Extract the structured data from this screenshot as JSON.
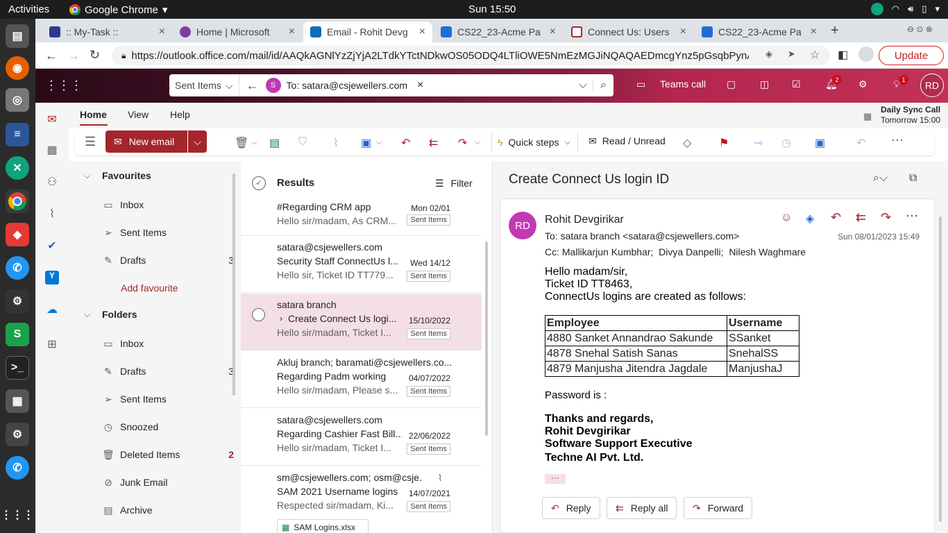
{
  "os": {
    "activities": "Activities",
    "app_name": "Google Chrome",
    "clock": "Sun 15:50"
  },
  "browser": {
    "tabs": [
      {
        "title": ":: My-Task ::",
        "color": "#2b3a8f"
      },
      {
        "title": "Home | Microsoft",
        "color": "#7b3fa0"
      },
      {
        "title": "Email - Rohit Devg",
        "color": "#0f6cbd"
      },
      {
        "title": "CS22_23-Acme Pac",
        "color": "#1e6fd9"
      },
      {
        "title": "Connect Us: Users",
        "color": "#a4262c"
      },
      {
        "title": "CS22_23-Acme Pac",
        "color": "#1e6fd9"
      }
    ],
    "url": "https://outlook.office.com/mail/id/AAQkAGNlYzZjYjA2LTdkYTctNDkwOS05ODQ4LTliOWE5NmEzMGJiNQAQAEDmcgYnz5pGsqbPynA4RGk...",
    "update_label": "Update"
  },
  "outlook": {
    "search_scope": "Sent Items",
    "search_chip_initial": "S",
    "search_chip_text": "To: satara@csjewellers.com",
    "teams_call": "Teams call",
    "notif_count": "2",
    "tips_count": "1",
    "user_initials": "RD",
    "reminder_title": "Daily Sync Call",
    "reminder_time": "Tomorrow 15:00"
  },
  "ribbon": {
    "tabs": [
      "Home",
      "View",
      "Help"
    ],
    "new_email": "New email",
    "quick_steps": "Quick steps",
    "read_unread": "Read / Unread"
  },
  "folders": {
    "favourites_header": "Favourites",
    "favourites": [
      {
        "name": "Inbox",
        "count": ""
      },
      {
        "name": "Sent Items",
        "count": ""
      },
      {
        "name": "Drafts",
        "count": "3"
      }
    ],
    "add_favourite": "Add favourite",
    "folders_header": "Folders",
    "items": [
      {
        "name": "Inbox",
        "count": ""
      },
      {
        "name": "Drafts",
        "count": "3"
      },
      {
        "name": "Sent Items",
        "count": ""
      },
      {
        "name": "Snoozed",
        "count": ""
      },
      {
        "name": "Deleted Items",
        "count": "2"
      },
      {
        "name": "Junk Email",
        "count": ""
      },
      {
        "name": "Archive",
        "count": ""
      }
    ]
  },
  "list": {
    "header": "Results",
    "filter": "Filter",
    "messages": [
      {
        "from": "",
        "subject": "#Regarding CRM app",
        "preview": "Hello sir/madam, As CRM...",
        "date": "Mon 02/01",
        "badge": "Sent Items"
      },
      {
        "from": "satara@csjewellers.com",
        "subject": "Security Staff ConnectUs l...",
        "preview": "Hello sir, Ticket ID TT779...",
        "date": "Wed 14/12",
        "badge": "Sent Items"
      },
      {
        "from": "satara branch",
        "subject": "Create Connect Us logi...",
        "preview": "Hello sir/madam, Ticket I...",
        "date": "15/10/2022",
        "badge": "Sent Items"
      },
      {
        "from": "Akluj branch; baramati@csjewellers.co...",
        "subject": "Regarding Padm working",
        "preview": "Hello sir/madam, Please s...",
        "date": "04/07/2022",
        "badge": "Sent Items"
      },
      {
        "from": "satara@csjewellers.com",
        "subject": "Regarding Cashier Fast Bill...",
        "preview": "Hello sir/madam, Ticket I...",
        "date": "22/06/2022",
        "badge": "Sent Items"
      },
      {
        "from": "sm@csjewellers.com; osm@csje...",
        "subject": "SAM 2021 Username logins",
        "preview": "Respected sir/madam, Ki...",
        "date": "14/07/2021",
        "badge": "Sent Items"
      }
    ],
    "attachment": "SAM Logins.xlsx"
  },
  "reading": {
    "subject": "Create Connect Us login ID",
    "sender_initials": "RD",
    "sender": "Rohit Devgirikar",
    "to_label": "To:",
    "to": "satara branch <satara@csjewellers.com>",
    "cc_label": "Cc:",
    "cc": "Mallikarjun Kumbhar;  Divya Danpelli;  Nilesh Waghmare",
    "date": "Sun 08/01/2023 15:49",
    "greeting": "Hello madam/sir,",
    "ticket": "Ticket ID TT8463,",
    "intro": "ConnectUs logins are created as follows:",
    "table_headers": [
      "Employee",
      "Username"
    ],
    "table_rows": [
      [
        "4880 Sanket Annandrao Sakunde",
        "SSanket"
      ],
      [
        "4878 Snehal Satish Sanas",
        "SnehalSS"
      ],
      [
        "4879 Manjusha Jitendra Jagdale",
        "ManjushaJ"
      ]
    ],
    "password": "Password is :",
    "sig1": "Thanks and regards,",
    "sig2": "Rohit Devgirikar",
    "sig3": "Software Support Executive",
    "sig4": "Techne AI Pvt. Ltd.",
    "more": "···",
    "reply": "Reply",
    "reply_all": "Reply all",
    "forward": "Forward"
  }
}
